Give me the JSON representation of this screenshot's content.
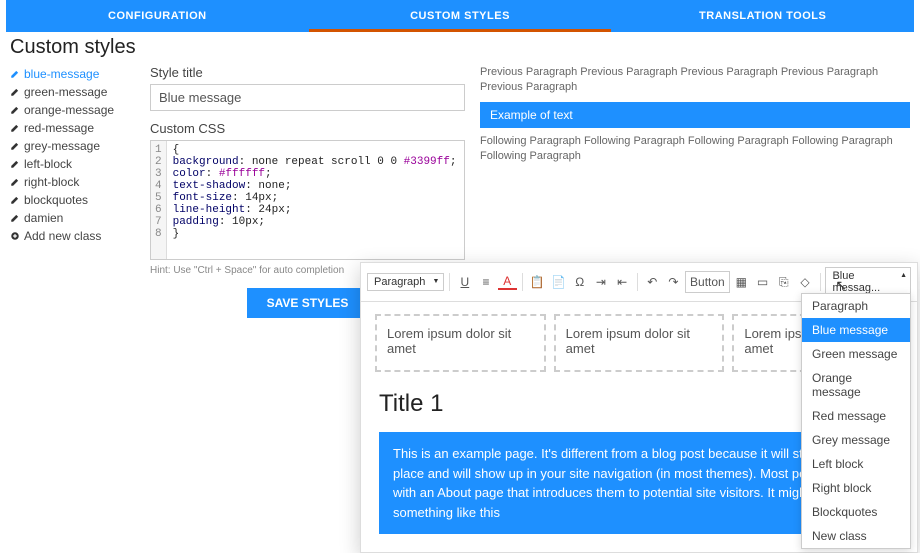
{
  "tabs": {
    "a": "CONFIGURATION",
    "b": "CUSTOM STYLES",
    "c": "TRANSLATION TOOLS"
  },
  "page_title": "Custom styles",
  "sidebar": {
    "items": [
      {
        "label": "blue-message"
      },
      {
        "label": "green-message"
      },
      {
        "label": "orange-message"
      },
      {
        "label": "red-message"
      },
      {
        "label": "grey-message"
      },
      {
        "label": "left-block"
      },
      {
        "label": "right-block"
      },
      {
        "label": "blockquotes"
      },
      {
        "label": "damien"
      }
    ],
    "add": "Add new class"
  },
  "form": {
    "title_label": "Style title",
    "title_value": "Blue message",
    "css_label": "Custom CSS",
    "css": {
      "l1": "{",
      "l2a": "background",
      "l2b": ": none repeat scroll 0 0 ",
      "l2c": "#3399ff",
      "l2d": ";",
      "l3a": "color",
      "l3b": ": ",
      "l3c": "#ffffff",
      "l3d": ";",
      "l4a": "text-shadow",
      "l4b": ": none;",
      "l5a": "font-size",
      "l5b": ": 14px;",
      "l6a": "line-height",
      "l6b": ": 24px;",
      "l7a": "padding",
      "l7b": ": 10px;",
      "l8": "}"
    },
    "hint": "Hint: Use \"Ctrl + Space\" for auto completion",
    "save": "SAVE STYLES"
  },
  "preview": {
    "prev": "Previous Paragraph Previous Paragraph Previous Paragraph Previous Paragraph Previous Paragraph",
    "example": "Example of text",
    "next": "Following Paragraph Following Paragraph Following Paragraph Following Paragraph Following Paragraph"
  },
  "editor": {
    "para": "Paragraph",
    "button_label": "Button",
    "style_sel": "Blue messag...",
    "dropdown": [
      "Paragraph",
      "Blue message",
      "Green message",
      "Orange message",
      "Red message",
      "Grey message",
      "Left block",
      "Right block",
      "Blockquotes",
      "New class"
    ],
    "lorem": "Lorem ipsum dolor sit amet",
    "title": "Title 1",
    "body": "This is an example page. It's different from a blog post because it will stay in one place and will show up in your site navigation (in most themes). Most people start with an About page that introduces them to potential site visitors. It might say something like this"
  }
}
